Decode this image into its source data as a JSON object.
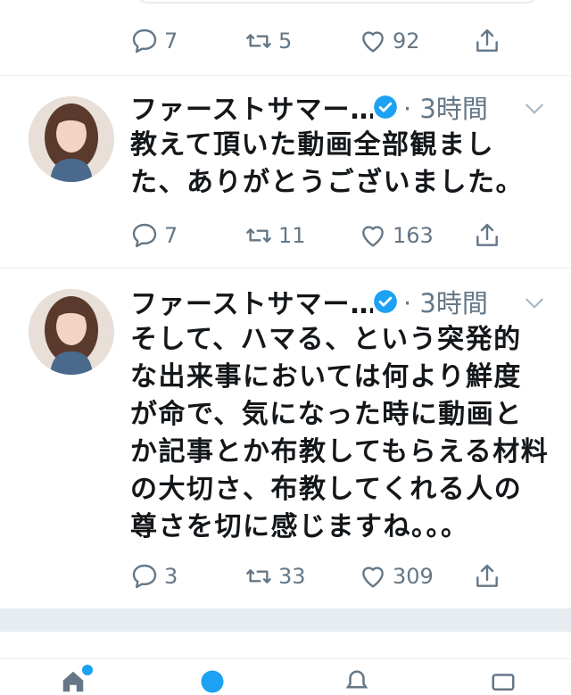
{
  "colors": {
    "accent": "#1da1f2",
    "muted": "#657786",
    "divider": "#e6ecf0"
  },
  "tweets": [
    {
      "reply": "7",
      "retweet": "5",
      "like": "92"
    },
    {
      "name": "ファーストサマー…",
      "time": "· 3時間",
      "text": "教えて頂いた動画全部観ました、ありがとうございました。",
      "reply": "7",
      "retweet": "11",
      "like": "163"
    },
    {
      "name": "ファーストサマー…",
      "time": "· 3時間",
      "text": "そして、ハマる、という突発的な出来事においては何より鮮度が命で、気になった時に動画とか記事とか布教してもらえる材料の大切さ、布教してくれる人の尊さを切に感じますね。。。",
      "reply": "3",
      "retweet": "33",
      "like": "309"
    }
  ],
  "tab_bar": {
    "icons": [
      "home-icon",
      "search-icon",
      "notifications-icon",
      "messages-icon"
    ]
  }
}
